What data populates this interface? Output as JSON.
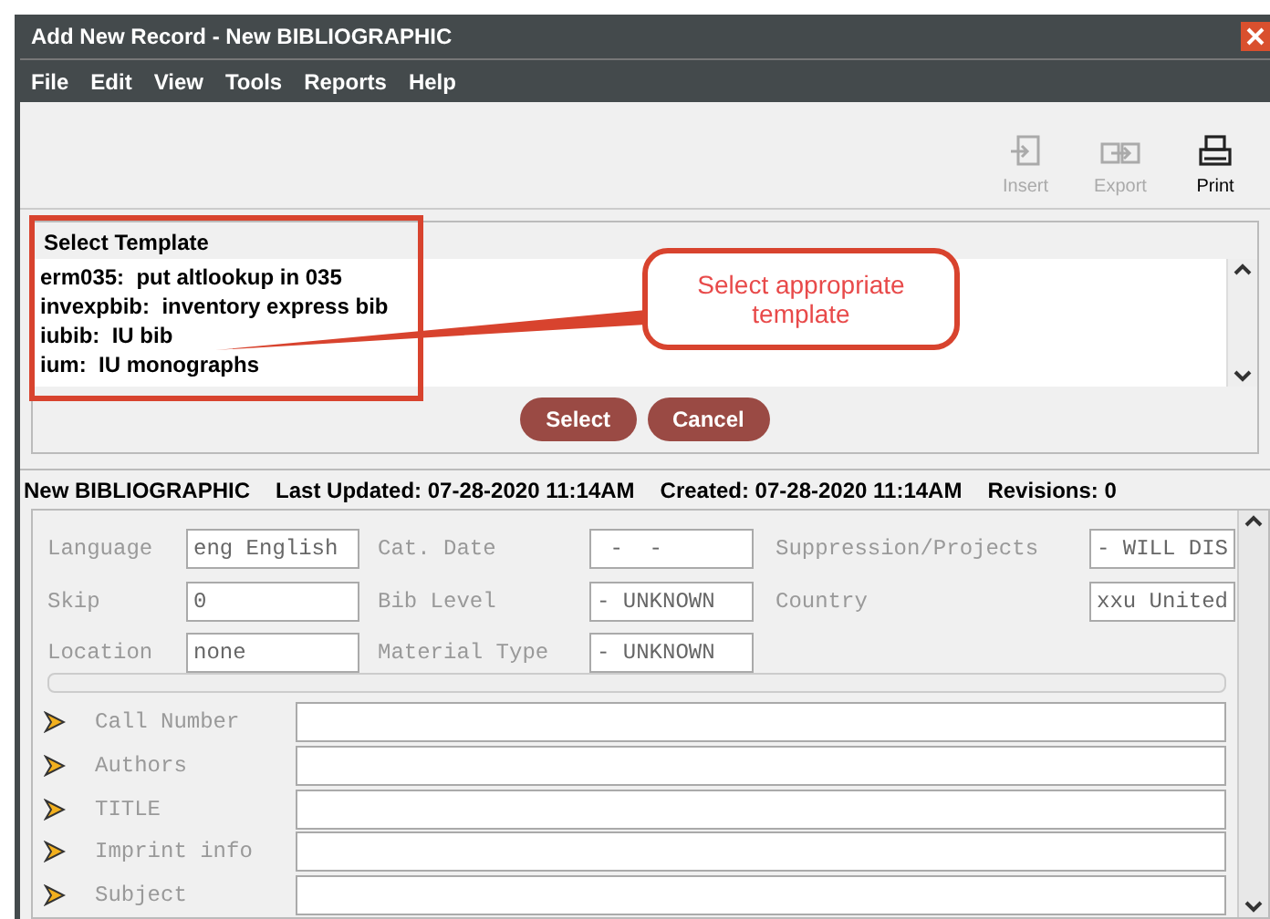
{
  "window": {
    "title": "Add New Record - New BIBLIOGRAPHIC"
  },
  "menu": [
    "File",
    "Edit",
    "View",
    "Tools",
    "Reports",
    "Help"
  ],
  "toolbar": [
    {
      "label": "Insert",
      "disabled": true,
      "kind": "insert"
    },
    {
      "label": "Export",
      "disabled": true,
      "kind": "export"
    },
    {
      "label": "Print",
      "disabled": false,
      "kind": "print"
    }
  ],
  "template_panel": {
    "title": "Select Template",
    "items": [
      {
        "code": "erm035:",
        "description": "put altlookup in 035"
      },
      {
        "code": "invexpbib:",
        "description": "inventory express bib"
      },
      {
        "code": "iubib:",
        "description": "IU bib"
      },
      {
        "code": "ium:",
        "description": "IU monographs"
      }
    ],
    "callout": "Select appropriate template",
    "buttons": [
      "Select",
      "Cancel"
    ]
  },
  "status": [
    {
      "label": "New BIBLIOGRAPHIC"
    },
    {
      "label": "Last Updated:",
      "value": "07-28-2020 11:14AM"
    },
    {
      "label": "Created:",
      "value": "07-28-2020 11:14AM"
    },
    {
      "label": "Revisions:",
      "value": "0"
    }
  ],
  "fixed_fields": [
    [
      {
        "label": "Language",
        "value": "eng English"
      },
      {
        "label": "Cat. Date",
        "value": " -  -"
      },
      {
        "label": "Suppression/Projects",
        "value": "- WILL DIS"
      }
    ],
    [
      {
        "label": "Skip",
        "value": "0"
      },
      {
        "label": "Bib Level",
        "value": "- UNKNOWN"
      },
      {
        "label": "Country",
        "value": "xxu United"
      }
    ],
    [
      {
        "label": "Location",
        "value": "none"
      },
      {
        "label": "Material Type",
        "value": "- UNKNOWN"
      }
    ]
  ],
  "var_fields": [
    "Call Number",
    "Authors",
    "TITLE",
    "Imprint info",
    "Subject"
  ]
}
